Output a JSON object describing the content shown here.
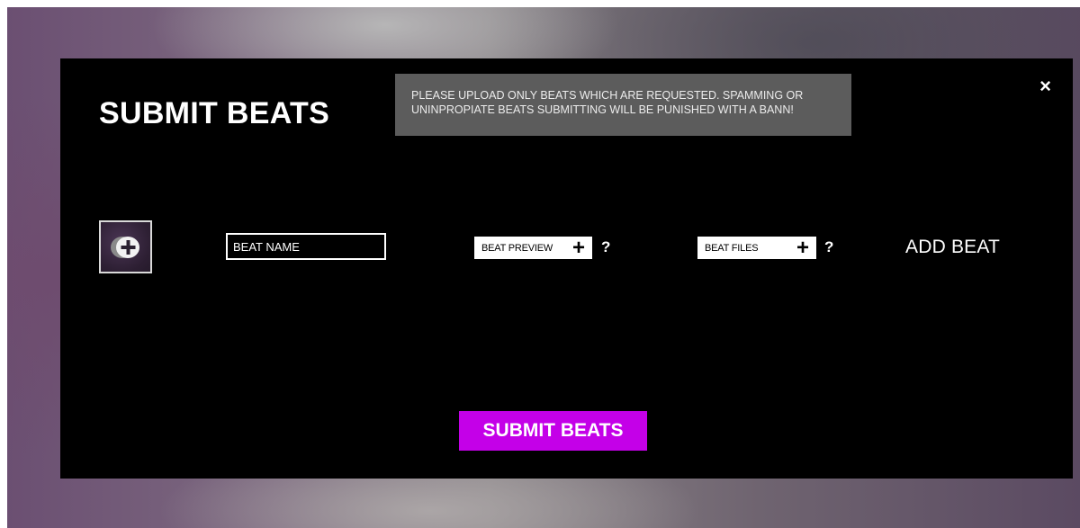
{
  "modal": {
    "title": "SUBMIT BEATS",
    "notice": "PLEASE UPLOAD ONLY BEATS WHICH ARE REQUESTED. SPAMMING OR UNINPROPIATE BEATS SUBMITTING WILL BE PUNISHED WITH A BANN!",
    "close_icon": "×"
  },
  "beat_row": {
    "cover_icon": "add-circle-icon",
    "beat_name_placeholder": "BEAT NAME",
    "preview_button": {
      "label": "BEAT PREVIEW",
      "plus": "+"
    },
    "preview_help": "?",
    "files_button": {
      "label": "BEAT FILES",
      "plus": "+"
    },
    "files_help": "?",
    "add_beat_label": "ADD BEAT"
  },
  "submit_button_label": "SUBMIT BEATS",
  "colors": {
    "modal_background": "#000000",
    "notice_background": "#5c5c5c",
    "submit_accent": "#c400e8"
  }
}
